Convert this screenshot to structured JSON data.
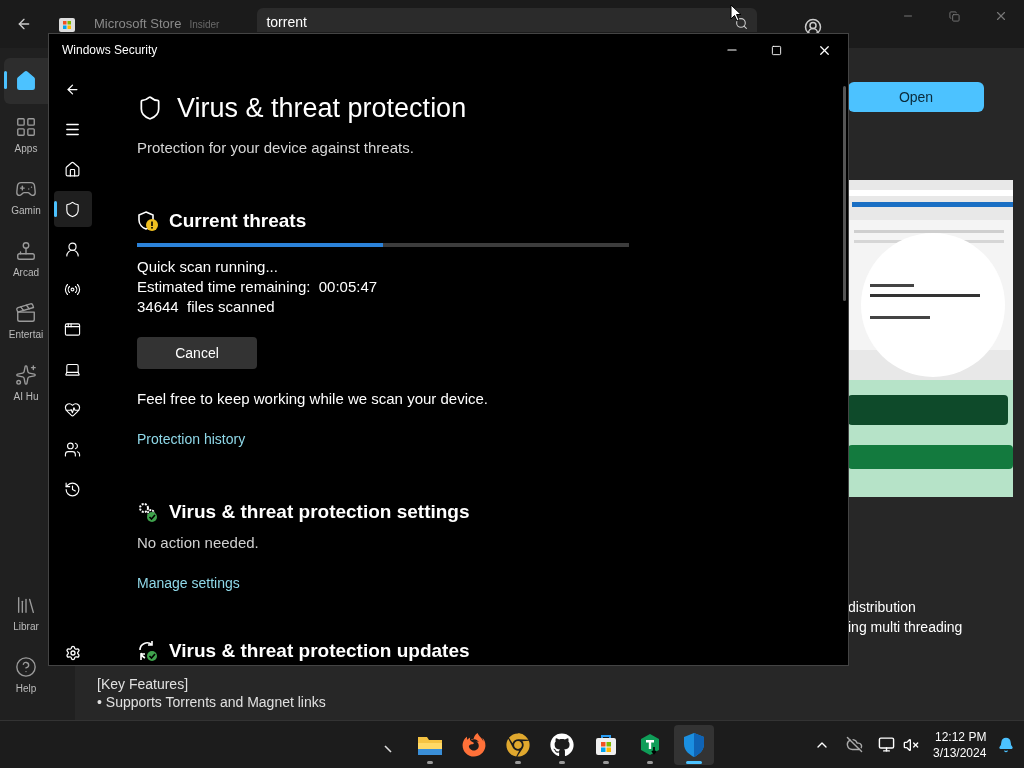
{
  "store": {
    "title": "Microsoft Store",
    "badge": "Insider",
    "search": {
      "value": "torrent"
    },
    "nav": [
      {
        "kind": "home",
        "selected": true
      },
      {
        "kind": "apps",
        "label": "Apps",
        "selected": false
      },
      {
        "kind": "gaming",
        "label": "Gamin",
        "selected": false
      },
      {
        "kind": "arcade",
        "label": "Arcad",
        "selected": false
      },
      {
        "kind": "entertainment",
        "label": "Entertai",
        "selected": false
      },
      {
        "kind": "ai",
        "label": "AI Hu",
        "selected": false
      }
    ],
    "nav_bottom": [
      {
        "kind": "library",
        "label": "Librar",
        "selected": false
      },
      {
        "kind": "help",
        "label": "Help",
        "selected": false
      }
    ],
    "open_button": "Open",
    "description_lines": [
      "distribution",
      "ing multi threading"
    ],
    "key_features": [
      "[Key Features]",
      "• Supports Torrents and Magnet links"
    ]
  },
  "security": {
    "title": "Windows Security",
    "nav": [
      {
        "kind": "home",
        "selected": false
      },
      {
        "kind": "shield",
        "selected": true
      },
      {
        "kind": "account",
        "selected": false
      },
      {
        "kind": "network",
        "selected": false
      },
      {
        "kind": "app",
        "selected": false
      },
      {
        "kind": "device",
        "selected": false
      },
      {
        "kind": "health",
        "selected": false
      },
      {
        "kind": "family",
        "selected": false
      },
      {
        "kind": "history",
        "selected": false
      }
    ],
    "page_title": "Virus & threat protection",
    "subtitle": "Protection for your device against threats.",
    "threats": {
      "heading": "Current threats",
      "level": 0.5,
      "lines": [
        "Quick scan running...",
        "Estimated time remaining:  00:05:47",
        "34644  files scanned"
      ],
      "cancel": "Cancel",
      "note": "Feel free to keep working while we scan your device.",
      "link": "Protection history"
    },
    "settings": {
      "heading": "Virus & threat protection settings",
      "status": "No action needed.",
      "link": "Manage settings"
    },
    "updates": {
      "heading": "Virus & threat protection updates"
    }
  },
  "taskbar": {
    "apps": [
      {
        "kind": "explorer",
        "running": true,
        "selected": false
      },
      {
        "kind": "firefox",
        "running": false,
        "selected": false
      },
      {
        "kind": "chrome",
        "running": true,
        "selected": false
      },
      {
        "kind": "github",
        "running": true,
        "selected": false
      },
      {
        "kind": "store",
        "running": true,
        "selected": false
      },
      {
        "kind": "torrent",
        "running": true,
        "selected": false
      },
      {
        "kind": "defender",
        "running": true,
        "selected": true
      }
    ],
    "time": "12:12 PM",
    "date": "3/13/2024"
  }
}
